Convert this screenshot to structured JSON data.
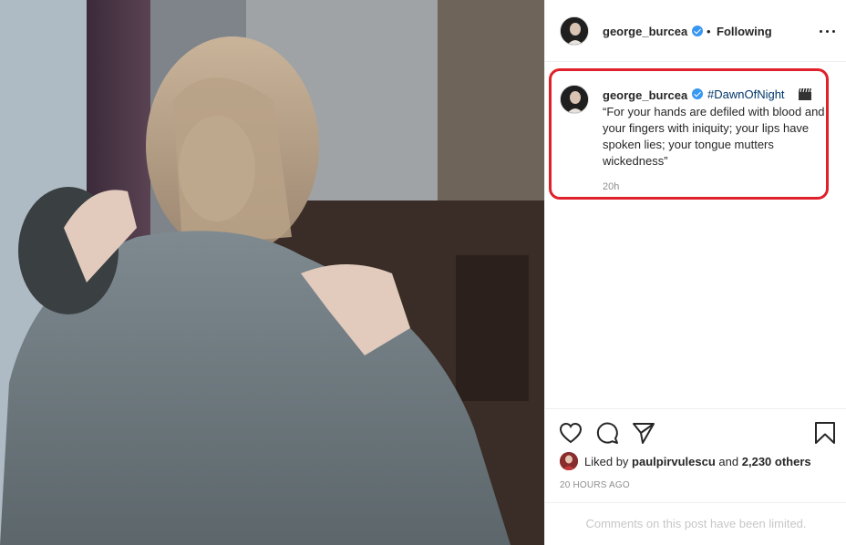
{
  "post": {
    "username": "george_burcea",
    "follow_status": "Following",
    "separator": "•",
    "caption": {
      "hashtag": "#DawnOfNight",
      "text": "“For your hands are defiled with blood and your fingers with iniquity; your lips have spoken lies; your tongue mutters wickedness”",
      "time": "20h"
    },
    "likes": {
      "prefix": "Liked by",
      "user": "paulpirvulescu",
      "conjunction": "and",
      "others": "2,230 others"
    },
    "posted_ago": "20 HOURS AGO",
    "comments_notice": "Comments on this post have been limited."
  },
  "icons": {
    "verified": "verified-badge-icon",
    "more": "more-options-icon",
    "like": "heart-icon",
    "comment": "comment-icon",
    "share": "paper-plane-icon",
    "save": "bookmark-icon",
    "clapper": "clapper-board-emoji"
  },
  "colors": {
    "highlight_border": "#e0202a",
    "hashtag": "#00376b",
    "verified": "#3897f0",
    "muted": "#8e8e8e"
  }
}
